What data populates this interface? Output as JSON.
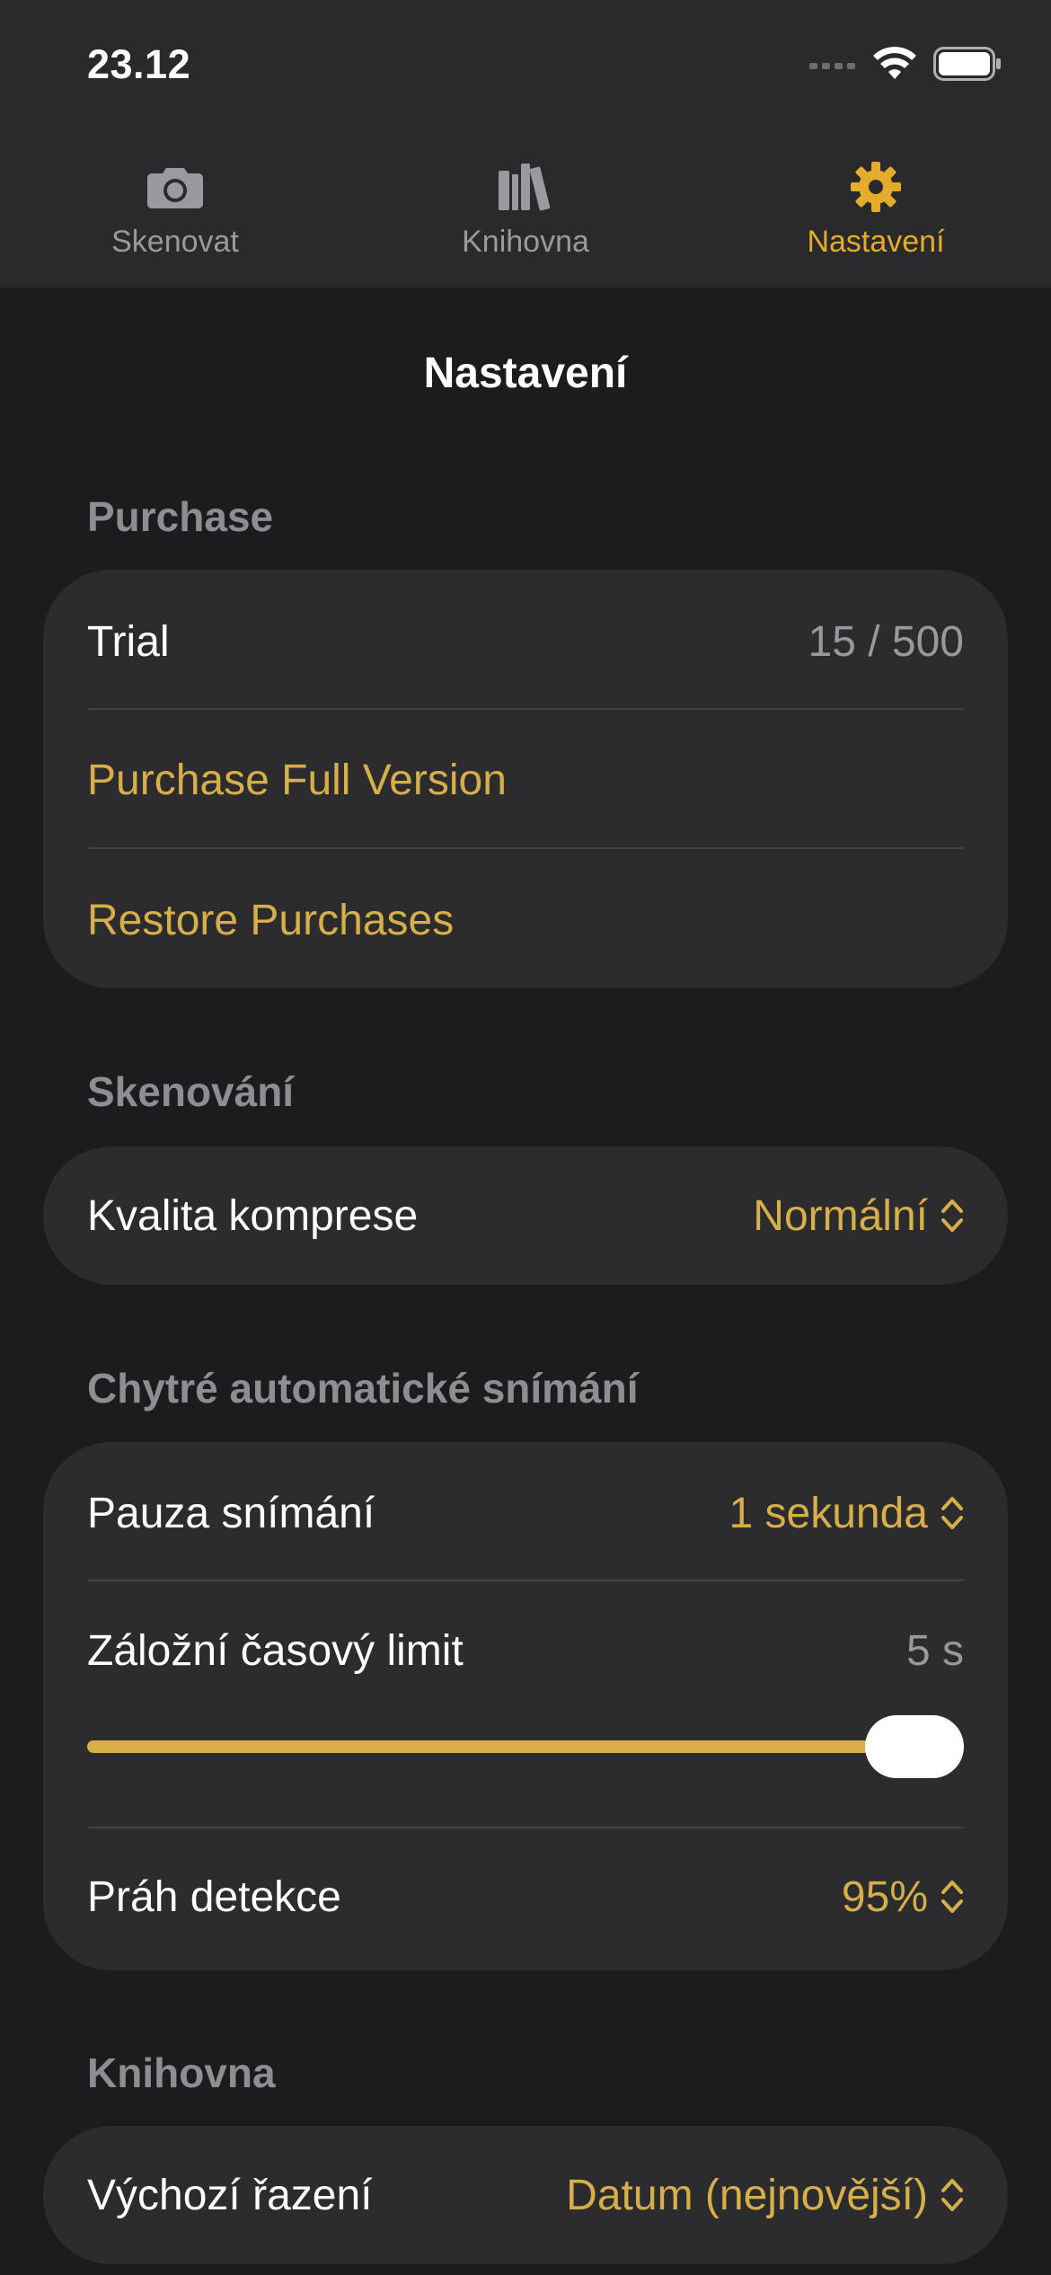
{
  "status": {
    "time": "23.12"
  },
  "tabs": [
    {
      "label": "Skenovat",
      "icon": "camera-icon",
      "active": false
    },
    {
      "label": "Knihovna",
      "icon": "library-icon",
      "active": false
    },
    {
      "label": "Nastavení",
      "icon": "gear-icon",
      "active": true
    }
  ],
  "page_title": "Nastavení",
  "sections": {
    "purchase": {
      "header": "Purchase",
      "trial_label": "Trial",
      "trial_value": "15 / 500",
      "purchase_full": "Purchase Full Version",
      "restore": "Restore Purchases"
    },
    "scanning": {
      "header": "Skenování",
      "compression_label": "Kvalita komprese",
      "compression_value": "Normální"
    },
    "smart_capture": {
      "header": "Chytré automatické snímání",
      "pause_label": "Pauza snímání",
      "pause_value": "1 sekunda",
      "timeout_label": "Záložní časový limit",
      "timeout_value": "5 s",
      "timeout_slider_fraction": 1.0,
      "threshold_label": "Práh detekce",
      "threshold_value": "95%"
    },
    "library": {
      "header": "Knihovna",
      "sort_label": "Výchozí řazení",
      "sort_value": "Datum (nejnovější)"
    }
  },
  "colors": {
    "accent": "#d6ae4a",
    "tab_active": "#e3ac2a",
    "background": "#1c1c1e",
    "card": "#2c2c2e"
  }
}
